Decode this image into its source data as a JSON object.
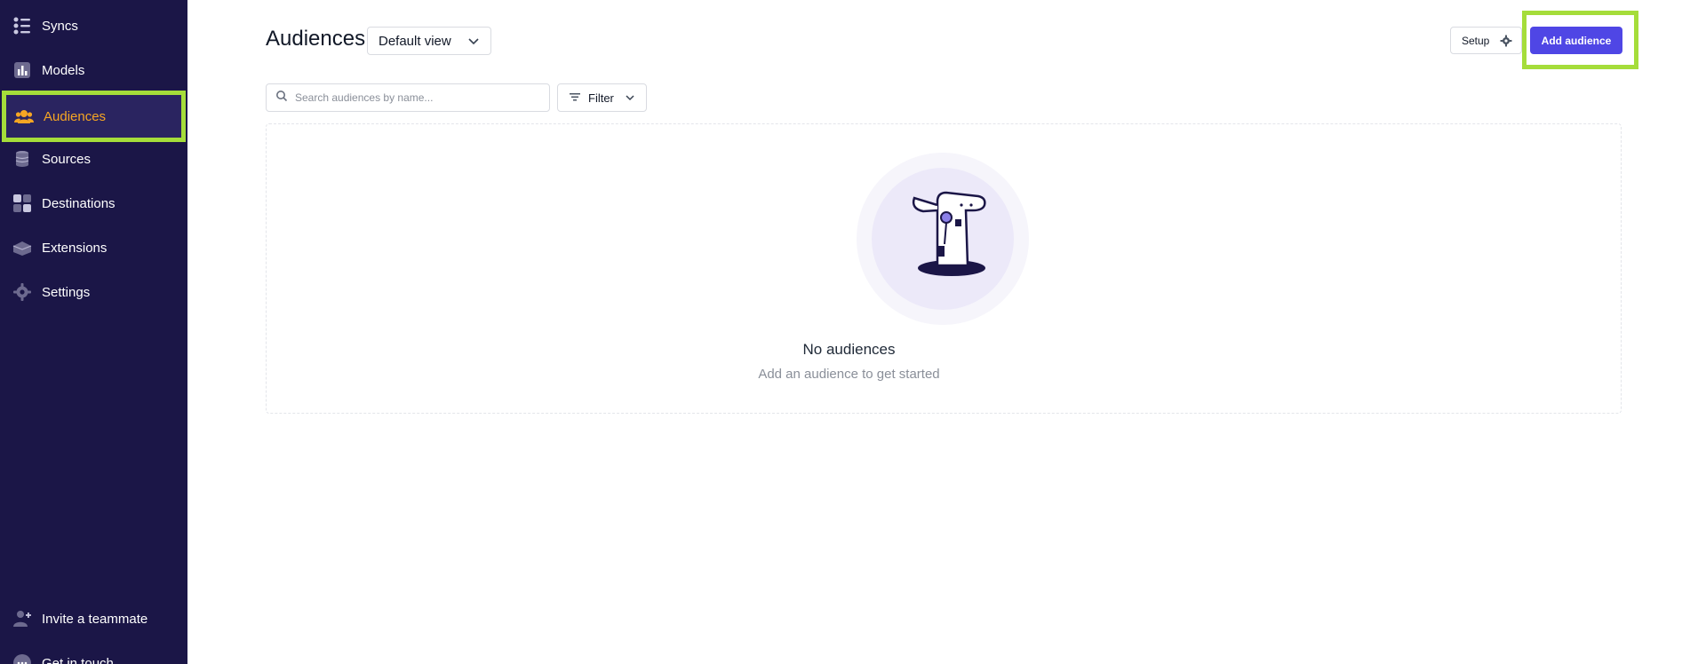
{
  "sidebar": {
    "items": [
      {
        "label": "Syncs",
        "icon": "syncs-icon"
      },
      {
        "label": "Models",
        "icon": "models-icon"
      },
      {
        "label": "Audiences",
        "icon": "audiences-icon",
        "active": true
      },
      {
        "label": "Sources",
        "icon": "sources-icon"
      },
      {
        "label": "Destinations",
        "icon": "destinations-icon"
      },
      {
        "label": "Extensions",
        "icon": "extensions-icon"
      },
      {
        "label": "Settings",
        "icon": "settings-icon"
      }
    ],
    "bottom": [
      {
        "label": "Invite a teammate",
        "icon": "invite-icon"
      },
      {
        "label": "Get in touch",
        "icon": "chat-icon"
      }
    ]
  },
  "header": {
    "title": "Audiences",
    "view_select": "Default view",
    "setup_label": "Setup",
    "add_label": "Add audience"
  },
  "toolbar": {
    "search_placeholder": "Search audiences by name...",
    "filter_label": "Filter"
  },
  "empty_state": {
    "title": "No audiences",
    "subtitle": "Add an audience to get started"
  },
  "colors": {
    "sidebar_bg": "#1b1647",
    "accent": "#4f46e5",
    "active_text": "#f6a623",
    "highlight": "#a5dd3a"
  }
}
